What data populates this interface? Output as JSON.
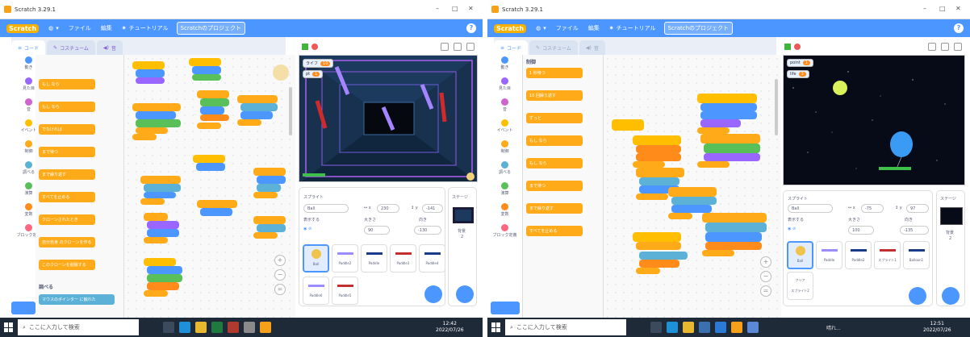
{
  "left": {
    "window_title": "Scratch 3.29.1",
    "menu": {
      "logo": "Scratch",
      "file": "ファイル",
      "edit": "編集",
      "tutorial": "チュートリアル",
      "project": "Scratchのプロジェクト"
    },
    "tabs": [
      {
        "label": "コード"
      },
      {
        "label": "コスチューム"
      },
      {
        "label": "音"
      }
    ],
    "categories": [
      {
        "label": "動き",
        "color": "#4c97ff"
      },
      {
        "label": "見た目",
        "color": "#9966ff"
      },
      {
        "label": "音",
        "color": "#cf63cf"
      },
      {
        "label": "イベント",
        "color": "#ffbf00"
      },
      {
        "label": "制御",
        "color": "#ffab19"
      },
      {
        "label": "調べる",
        "color": "#5cb1d6"
      },
      {
        "label": "演算",
        "color": "#59c059"
      },
      {
        "label": "変数",
        "color": "#ff8c1a"
      },
      {
        "label": "ブロック定義",
        "color": "#ff6680"
      }
    ],
    "palette_blocks": [
      "もし なら",
      "もし なら",
      "でなければ",
      "まで待つ",
      "まで繰り返す",
      "すべてを止める",
      "クローンされたとき",
      "自分自身 のクローンを作る",
      "このクローンを削除する"
    ],
    "palette_footer": "調べる",
    "palette_sensing": "マウスのポインター に触れた",
    "monitors": [
      {
        "label": "ライフ",
        "value": "10"
      },
      {
        "label": "pt",
        "value": "1"
      }
    ],
    "sprite_pane": {
      "title": "スプライト",
      "name": "Ball",
      "x": "230",
      "y": "-141",
      "show": "表示する",
      "size_label": "大きさ",
      "size": "90",
      "dir_label": "向き",
      "dir": "-130"
    },
    "sprites": [
      "Ball",
      "Paddle2",
      "Paddle",
      "Paddle3",
      "Paddle4",
      "Paddle6",
      "Paddle5"
    ],
    "stage_panel": {
      "title": "ステージ",
      "backdrop_label": "背景",
      "backdrop_count": "2"
    },
    "taskbar": {
      "search": "ここに入力して検索",
      "time": "12:42",
      "date": "2022/07/26"
    }
  },
  "right": {
    "window_title": "Scratch 3.29.1",
    "menu": {
      "logo": "Scratch",
      "file": "ファイル",
      "edit": "編集",
      "tutorial": "チュートリアル",
      "project": "Scratchのプロジェクト"
    },
    "tabs": [
      {
        "label": "コード"
      },
      {
        "label": "コスチューム"
      },
      {
        "label": "音"
      }
    ],
    "categories": [
      {
        "label": "動き",
        "color": "#4c97ff"
      },
      {
        "label": "見た目",
        "color": "#9966ff"
      },
      {
        "label": "音",
        "color": "#cf63cf"
      },
      {
        "label": "イベント",
        "color": "#ffbf00"
      },
      {
        "label": "制御",
        "color": "#ffab19"
      },
      {
        "label": "調べる",
        "color": "#5cb1d6"
      },
      {
        "label": "演算",
        "color": "#59c059"
      },
      {
        "label": "変数",
        "color": "#ff8c1a"
      },
      {
        "label": "ブロック定義",
        "color": "#ff6680"
      }
    ],
    "palette_title": "制御",
    "palette_blocks": [
      "1 秒待つ",
      "10 回繰り返す",
      "ずっと",
      "もし なら",
      "もし なら",
      "まで待つ",
      "まで繰り返す",
      "すべてを止める"
    ],
    "workspace_blocks": [
      "緑の旗が押されたとき",
      "point を 0 にする",
      "life を 3 にする",
      "ずっと",
      "もし Paddle に触れた なら",
      "向き 回に回す",
      "後ろ",
      "point を 1 ずつ変える",
      "もし Paddle2 に触れた なら"
    ],
    "monitors": [
      {
        "label": "point",
        "value": "1"
      },
      {
        "label": "life",
        "value": "3"
      }
    ],
    "sprite_pane": {
      "title": "スプライト",
      "name": "Ball",
      "x": "-75",
      "y": "97",
      "show": "表示する",
      "size_label": "大きさ",
      "size": "100",
      "dir_label": "向き",
      "dir": "-135"
    },
    "sprites": [
      "Ball",
      "Paddle",
      "Paddle2",
      "スプライト1",
      "Balloon1"
    ],
    "extra_sprite": {
      "label": "クリア",
      "sub": "スプライト2"
    },
    "stage_panel": {
      "title": "ステージ",
      "backdrop_label": "背景",
      "backdrop_count": "2"
    },
    "taskbar": {
      "search": "ここに入力して検索",
      "tray_text": "晴れ...",
      "time": "12:51",
      "date": "2022/07/26"
    }
  }
}
